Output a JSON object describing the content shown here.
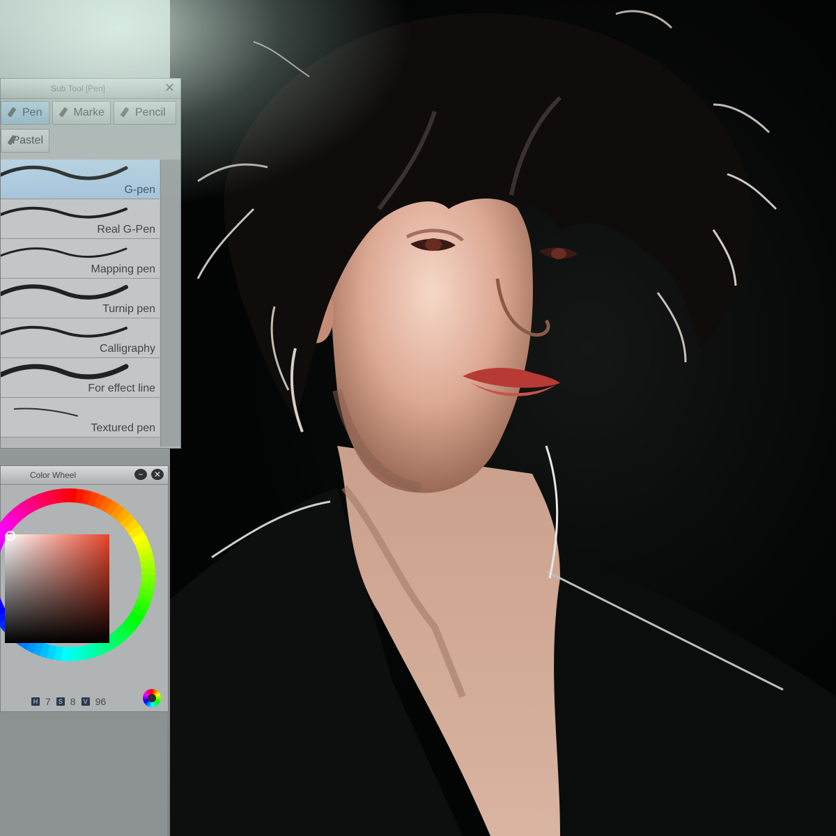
{
  "subtool_panel": {
    "title": "Sub Tool [Pen]",
    "categories": [
      {
        "label": "Pen",
        "icon": "pen-icon",
        "active": true
      },
      {
        "label": "Marke",
        "icon": "marker-icon",
        "active": false
      },
      {
        "label": "Pencil",
        "icon": "pencil-icon",
        "active": false
      },
      {
        "label": "Pastel",
        "icon": "pastel-icon",
        "active": false
      }
    ],
    "brushes": [
      {
        "label": "G-pen",
        "selected": true
      },
      {
        "label": "Real G-Pen",
        "selected": false
      },
      {
        "label": "Mapping pen",
        "selected": false
      },
      {
        "label": "Turnip pen",
        "selected": false
      },
      {
        "label": "Calligraphy",
        "selected": false
      },
      {
        "label": "For effect line",
        "selected": false
      },
      {
        "label": "Textured pen",
        "selected": false
      }
    ]
  },
  "color_wheel_panel": {
    "title": "Color Wheel",
    "h_label": "H",
    "h_value": "7",
    "s_label": "S",
    "s_value": "8",
    "v_label": "V",
    "v_value": "96",
    "selected_hue_color": "#e8442a"
  },
  "canvas": {
    "background_color": "#0a0c0b",
    "content": "digital painting of a portrait"
  }
}
